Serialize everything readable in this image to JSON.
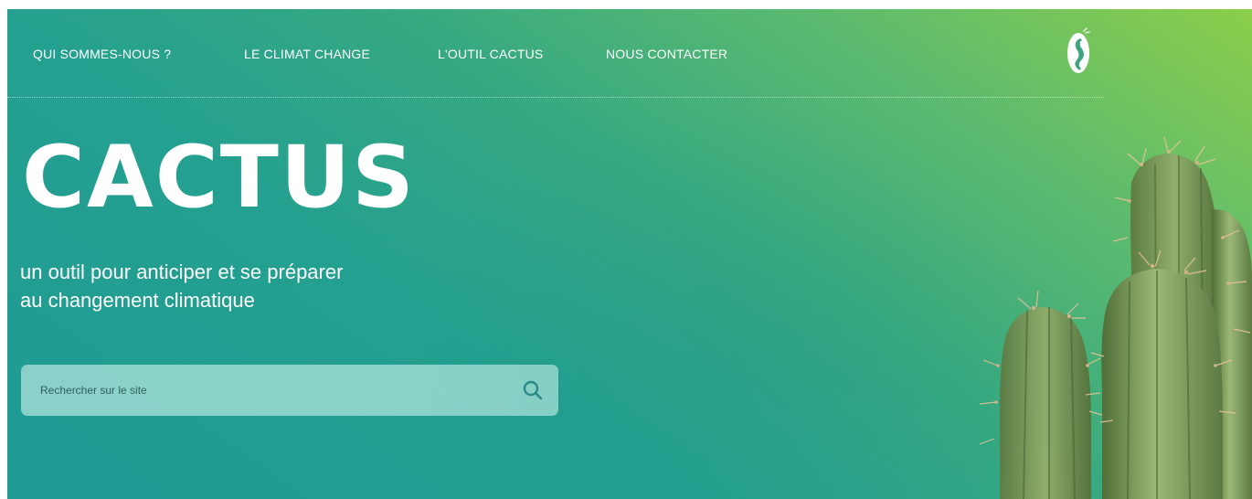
{
  "nav": {
    "items": [
      {
        "label": "QUI SOMMES-NOUS ?"
      },
      {
        "label": "LE CLIMAT CHANGE"
      },
      {
        "label": "L'OUTIL CACTUS"
      },
      {
        "label": "NOUS CONTACTER"
      }
    ],
    "logo_icon": "seahorse-logo-icon"
  },
  "hero": {
    "title": "CACTUS",
    "subtitle_line1": "un outil pour anticiper et se préparer",
    "subtitle_line2": "au changement climatique",
    "image": "cactus-photo"
  },
  "search": {
    "placeholder": "Rechercher sur le site",
    "value": "",
    "button_icon": "search-icon"
  },
  "colors": {
    "gradient_top_right": "#8cce4a",
    "gradient_bottom_left": "#1f9a94",
    "search_bg": "#b4e6de",
    "search_icon": "#2e8a86"
  }
}
